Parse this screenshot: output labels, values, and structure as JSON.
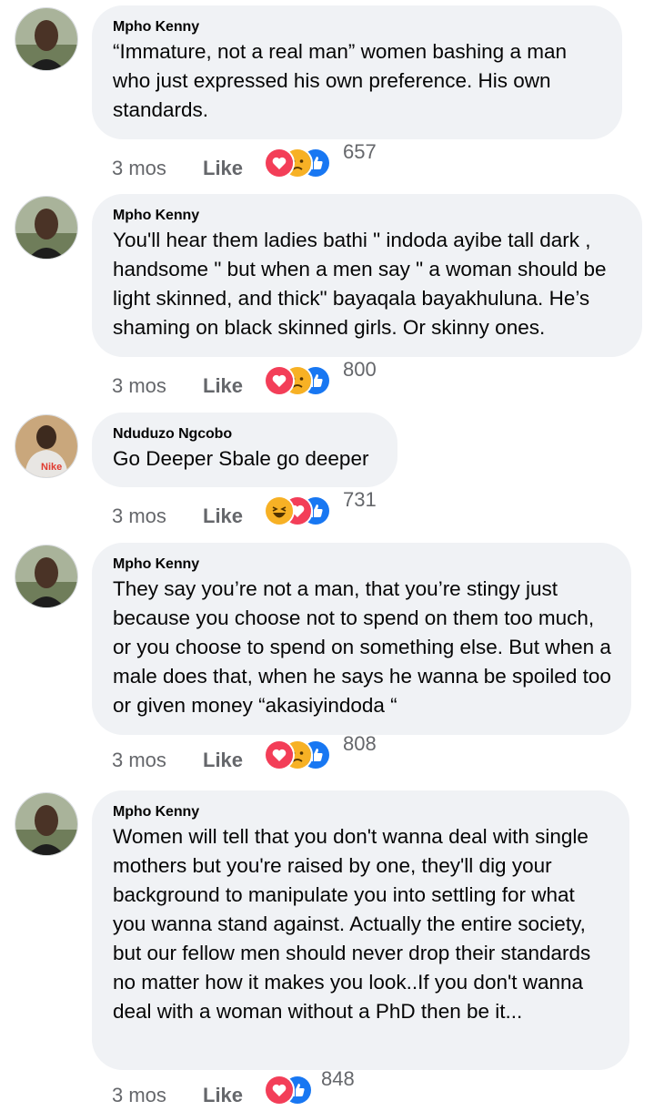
{
  "comments": [
    {
      "author": "Mpho Kenny",
      "text": "“Immature, not a real man” women bashing a man who just expressed his own preference. His own standards.",
      "time": "3 mos",
      "like_label": "Like",
      "reactions": [
        "love-icon",
        "care-icon",
        "like-icon"
      ],
      "count": "657"
    },
    {
      "author": "Mpho Kenny",
      "text": "You'll hear them ladies bathi \" indoda ayibe tall dark , handsome \" but when a men say \" a woman should be light skinned, and thick\" bayaqala bayakhuluna. He’s shaming on black skinned girls. Or skinny ones.",
      "time": "3 mos",
      "like_label": "Like",
      "reactions": [
        "love-icon",
        "care-icon",
        "like-icon"
      ],
      "count": "800"
    },
    {
      "author": "Nduduzo Ngcobo",
      "text": "Go Deeper Sbale go deeper",
      "time": "3 mos",
      "like_label": "Like",
      "reactions": [
        "haha-icon",
        "love-icon",
        "like-icon"
      ],
      "count": "731"
    },
    {
      "author": "Mpho Kenny",
      "text": "They say you’re not a man, that you’re stingy just because you choose not to spend on them too much, or you choose to spend on something else. But when a male does that, when he says he wanna be spoiled too or given money “akasiyindoda “",
      "time": "3 mos",
      "like_label": "Like",
      "reactions": [
        "love-icon",
        "care-icon",
        "like-icon"
      ],
      "count": "808"
    },
    {
      "author": "Mpho Kenny",
      "text": "Women will tell that you don't wanna deal with single mothers but you're raised by one, they'll dig your background to manipulate you into settling for what you wanna stand against. Actually the entire society, but our fellow men should never drop their standards no matter how it makes you look..If you don't wanna deal with a woman without a PhD then be it...",
      "time": "3 mos",
      "like_label": "Like",
      "reactions": [
        "love-icon",
        "like-icon"
      ],
      "count": "848"
    }
  ],
  "colors": {
    "bubble": "#f0f2f5",
    "meta_text": "#65676b",
    "love": "#f33e58",
    "like": "#1877f2",
    "haha": "#f7b125"
  }
}
